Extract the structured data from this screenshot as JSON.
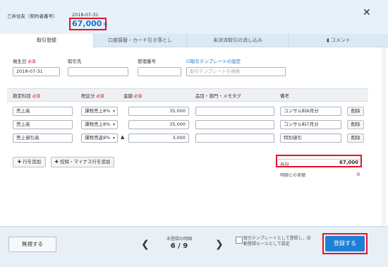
{
  "header": {
    "payee": "三井住友（契約者番号）",
    "date": "2018-07-31",
    "amount": "67,000",
    "currency": "円",
    "close": "✕"
  },
  "tabs": [
    {
      "label": "取引登録"
    },
    {
      "label": "口座振替・カード引き落とし"
    },
    {
      "label": "未決済取引の消し込み"
    },
    {
      "label": "コメント"
    }
  ],
  "form": {
    "date_label": "発生日",
    "required": "必須",
    "date_value": "2018-07-31",
    "partner_label": "取引先",
    "mgmt_label": "管理番号",
    "template_link": "取引テンプレートの設定",
    "template_placeholder": "取引テンプレートを検索"
  },
  "table": {
    "headers": {
      "account": "勘定科目",
      "tax": "税区分",
      "amount": "金額",
      "item": "品目・部門・メモタグ",
      "note": "備考"
    },
    "rows": [
      {
        "account": "売上高",
        "tax": "課税売上8%",
        "sign": "",
        "amount": "35,000",
        "note": "コンサル料6月分",
        "delete": "削除"
      },
      {
        "account": "売上高",
        "tax": "課税売上8%",
        "sign": "",
        "amount": "35,000",
        "note": "コンサル料7月分",
        "delete": "削除"
      },
      {
        "account": "売上値引高",
        "tax": "課税売返8%",
        "sign": "▲",
        "amount": "3,000",
        "note": "特別値引",
        "delete": "削除"
      }
    ]
  },
  "actions": {
    "add_row": "行を追加",
    "add_adjust": "控除・マイナス行を追加",
    "total_label": "合計",
    "total_value": "67,000",
    "diff_label": "明細との差額",
    "diff_value": "0"
  },
  "footer": {
    "invalid": "無視する",
    "unregistered_label": "未登録の明細",
    "pager": "6 / 9",
    "checkbox_label": "取引テンプレートとして登録し、自動登録ルールとして設定",
    "register": "登録する"
  },
  "colors": {
    "accent": "#1a73c9",
    "highlight": "#e8102a",
    "primary_button": "#1f7fd6"
  }
}
